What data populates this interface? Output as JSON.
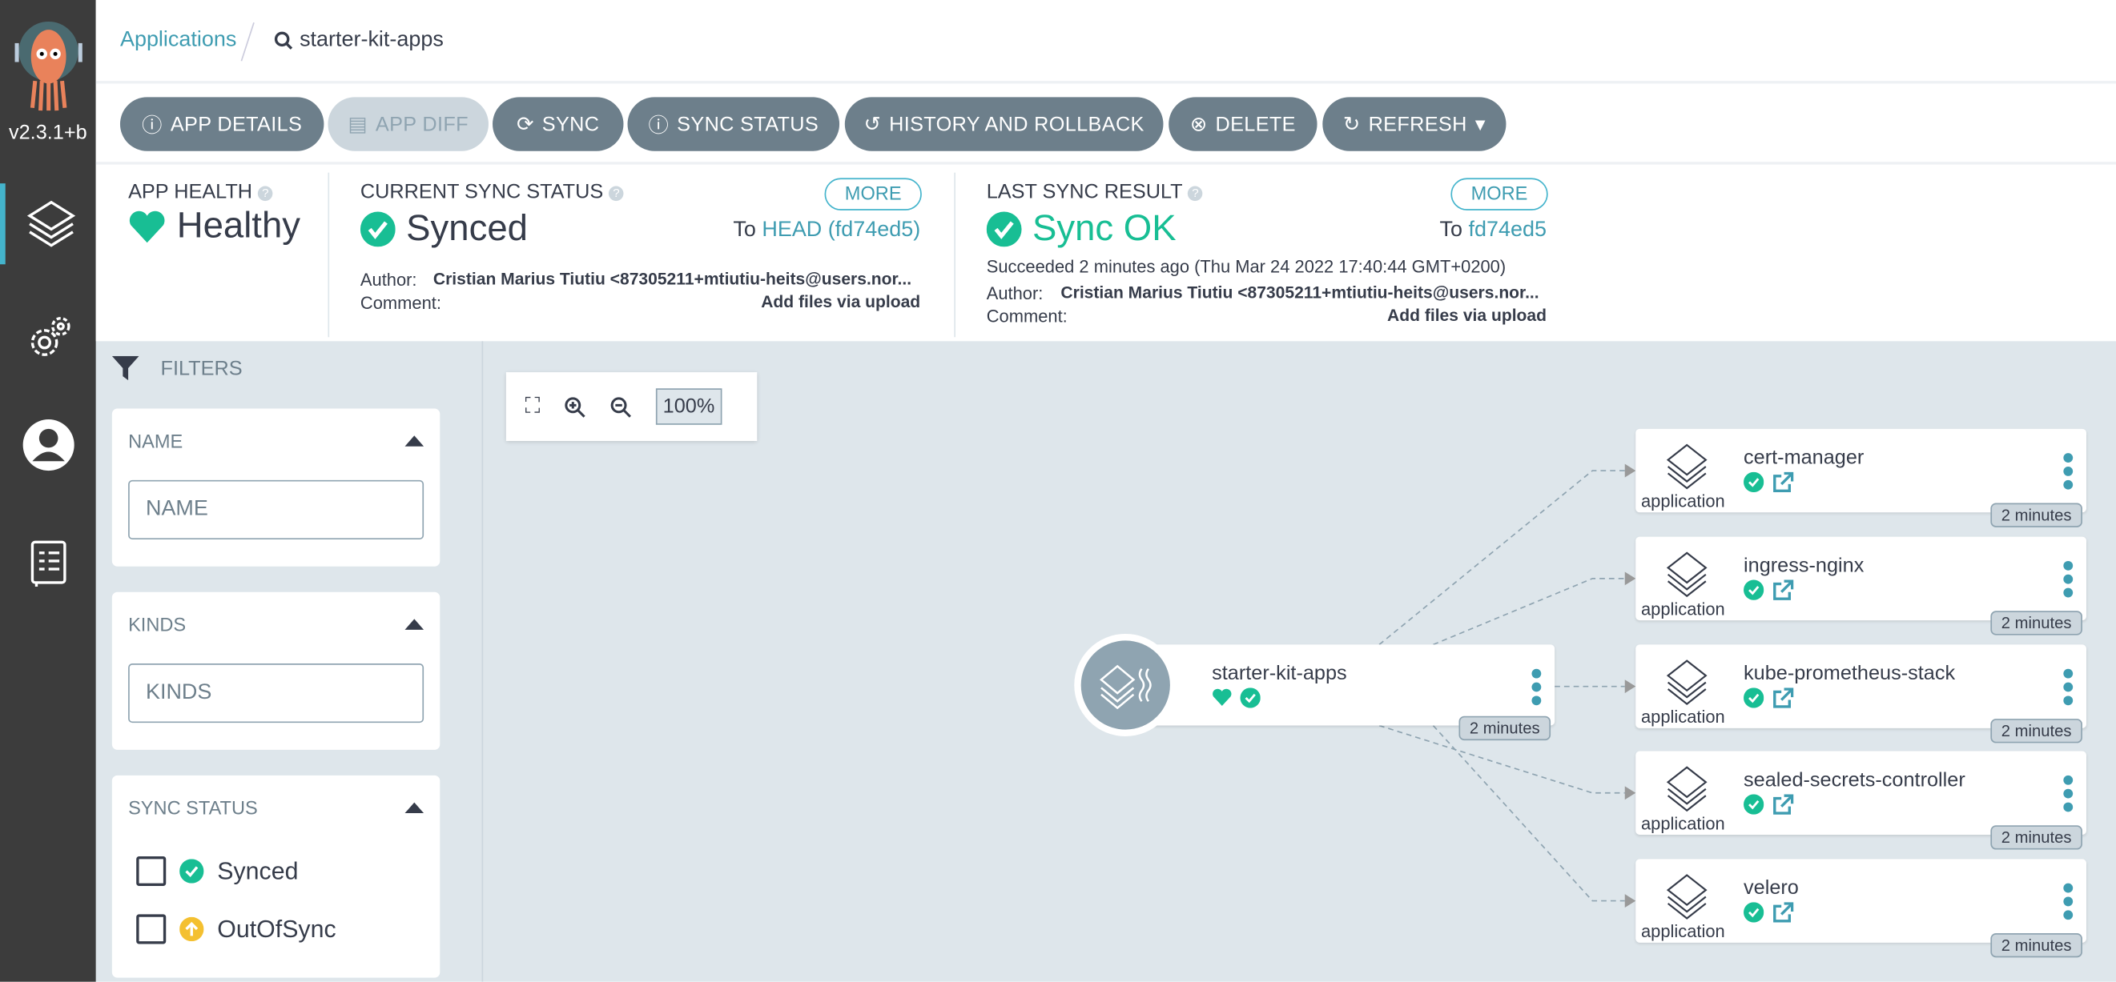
{
  "sidebar": {
    "version": "v2.3.1+b",
    "items": [
      "applications",
      "settings",
      "user-info",
      "docs"
    ]
  },
  "breadcrumb": {
    "root": "Applications",
    "current": "starter-kit-apps"
  },
  "toolbar": {
    "app_details": "APP DETAILS",
    "app_diff": "APP DIFF",
    "sync": "SYNC",
    "sync_status": "SYNC STATUS",
    "history": "HISTORY AND ROLLBACK",
    "delete": "DELETE",
    "refresh": "REFRESH"
  },
  "health": {
    "label": "APP HEALTH",
    "value": "Healthy"
  },
  "current_sync": {
    "label": "CURRENT SYNC STATUS",
    "more": "MORE",
    "value": "Synced",
    "to_prefix": "To",
    "to_ref": "HEAD (fd74ed5)",
    "author_label": "Author:",
    "author": "Cristian Marius Tiutiu <87305211+mtiutiu-heits@users.nor...",
    "comment_label": "Comment:",
    "comment": "Add files via upload"
  },
  "last_sync": {
    "label": "LAST SYNC RESULT",
    "more": "MORE",
    "value": "Sync OK",
    "to_prefix": "To",
    "to_ref": "fd74ed5",
    "succeeded": "Succeeded 2 minutes ago (Thu Mar 24 2022 17:40:44 GMT+0200)",
    "author_label": "Author:",
    "author": "Cristian Marius Tiutiu <87305211+mtiutiu-heits@users.nor...",
    "comment_label": "Comment:",
    "comment": "Add files via upload"
  },
  "filters": {
    "title": "FILTERS",
    "name": {
      "header": "NAME",
      "placeholder": "NAME"
    },
    "kinds": {
      "header": "KINDS",
      "placeholder": "KINDS"
    },
    "sync_status": {
      "header": "SYNC STATUS",
      "options": [
        "Synced",
        "OutOfSync"
      ]
    }
  },
  "zoom": {
    "level": "100%"
  },
  "graph": {
    "root": {
      "name": "starter-kit-apps",
      "age": "2 minutes"
    },
    "children": [
      {
        "name": "cert-manager",
        "kind": "application",
        "age": "2 minutes"
      },
      {
        "name": "ingress-nginx",
        "kind": "application",
        "age": "2 minutes"
      },
      {
        "name": "kube-prometheus-stack",
        "kind": "application",
        "age": "2 minutes"
      },
      {
        "name": "sealed-secrets-controller",
        "kind": "application",
        "age": "2 minutes"
      },
      {
        "name": "velero",
        "kind": "application",
        "age": "2 minutes"
      }
    ]
  },
  "colors": {
    "accent": "#3e9cb1",
    "healthy": "#18be94",
    "button": "#6d7f8b",
    "outofsync": "#f4c030"
  }
}
